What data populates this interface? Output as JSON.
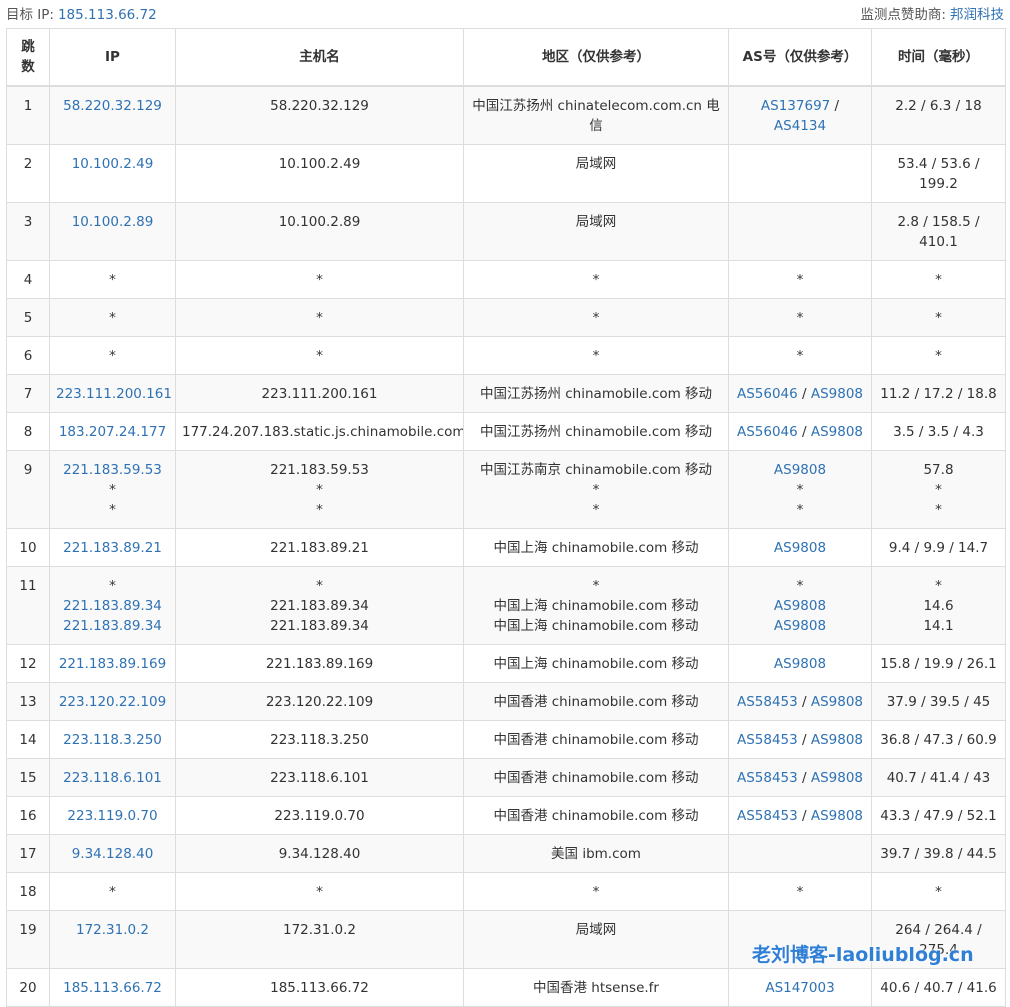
{
  "header": {
    "target_label": "目标 IP:",
    "target_ip": "185.113.66.72",
    "sponsor_label": "监测点赞助商:",
    "sponsor_name": "邦润科技"
  },
  "columns": [
    "跳数",
    "IP",
    "主机名",
    "地区（仅供参考）",
    "AS号（仅供参考）",
    "时间（毫秒）"
  ],
  "rows": [
    {
      "hop": "1",
      "ip": [
        "58.220.32.129"
      ],
      "host": [
        "58.220.32.129"
      ],
      "region": [
        "中国江苏扬州 chinatelecom.com.cn 电信"
      ],
      "as": [
        [
          "AS137697",
          "AS4134"
        ]
      ],
      "time": [
        "2.2 / 6.3 / 18"
      ]
    },
    {
      "hop": "2",
      "ip": [
        "10.100.2.49"
      ],
      "host": [
        "10.100.2.49"
      ],
      "region": [
        "局域网"
      ],
      "as": [
        []
      ],
      "time": [
        "53.4 / 53.6 / 199.2"
      ]
    },
    {
      "hop": "3",
      "ip": [
        "10.100.2.89"
      ],
      "host": [
        "10.100.2.89"
      ],
      "region": [
        "局域网"
      ],
      "as": [
        []
      ],
      "time": [
        "2.8 / 158.5 / 410.1"
      ]
    },
    {
      "hop": "4",
      "ip": [
        "*"
      ],
      "host": [
        "*"
      ],
      "region": [
        "*"
      ],
      "as": [
        [
          "*"
        ]
      ],
      "time": [
        "*"
      ]
    },
    {
      "hop": "5",
      "ip": [
        "*"
      ],
      "host": [
        "*"
      ],
      "region": [
        "*"
      ],
      "as": [
        [
          "*"
        ]
      ],
      "time": [
        "*"
      ]
    },
    {
      "hop": "6",
      "ip": [
        "*"
      ],
      "host": [
        "*"
      ],
      "region": [
        "*"
      ],
      "as": [
        [
          "*"
        ]
      ],
      "time": [
        "*"
      ]
    },
    {
      "hop": "7",
      "ip": [
        "223.111.200.161"
      ],
      "host": [
        "223.111.200.161"
      ],
      "region": [
        "中国江苏扬州 chinamobile.com 移动"
      ],
      "as": [
        [
          "AS56046",
          "AS9808"
        ]
      ],
      "time": [
        "11.2 / 17.2 / 18.8"
      ]
    },
    {
      "hop": "8",
      "ip": [
        "183.207.24.177"
      ],
      "host": [
        "177.24.207.183.static.js.chinamobile.com"
      ],
      "region": [
        "中国江苏扬州 chinamobile.com 移动"
      ],
      "as": [
        [
          "AS56046",
          "AS9808"
        ]
      ],
      "time": [
        "3.5 / 3.5 / 4.3"
      ]
    },
    {
      "hop": "9",
      "ip": [
        "221.183.59.53",
        "*",
        "*"
      ],
      "host": [
        "221.183.59.53",
        "*",
        "*"
      ],
      "region": [
        "中国江苏南京 chinamobile.com 移动",
        "*",
        "*"
      ],
      "as": [
        [
          "AS9808"
        ],
        [
          "*"
        ],
        [
          "*"
        ]
      ],
      "time": [
        "57.8",
        "*",
        "*"
      ]
    },
    {
      "hop": "10",
      "ip": [
        "221.183.89.21"
      ],
      "host": [
        "221.183.89.21"
      ],
      "region": [
        "中国上海 chinamobile.com 移动"
      ],
      "as": [
        [
          "AS9808"
        ]
      ],
      "time": [
        "9.4 / 9.9 / 14.7"
      ]
    },
    {
      "hop": "11",
      "ip": [
        "*",
        "221.183.89.34",
        "221.183.89.34"
      ],
      "host": [
        "*",
        "221.183.89.34",
        "221.183.89.34"
      ],
      "region": [
        "*",
        "中国上海 chinamobile.com 移动",
        "中国上海 chinamobile.com 移动"
      ],
      "as": [
        [
          "*"
        ],
        [
          "AS9808"
        ],
        [
          "AS9808"
        ]
      ],
      "time": [
        "*",
        "14.6",
        "14.1"
      ]
    },
    {
      "hop": "12",
      "ip": [
        "221.183.89.169"
      ],
      "host": [
        "221.183.89.169"
      ],
      "region": [
        "中国上海 chinamobile.com 移动"
      ],
      "as": [
        [
          "AS9808"
        ]
      ],
      "time": [
        "15.8 / 19.9 / 26.1"
      ]
    },
    {
      "hop": "13",
      "ip": [
        "223.120.22.109"
      ],
      "host": [
        "223.120.22.109"
      ],
      "region": [
        "中国香港 chinamobile.com 移动"
      ],
      "as": [
        [
          "AS58453",
          "AS9808"
        ]
      ],
      "time": [
        "37.9 / 39.5 / 45"
      ]
    },
    {
      "hop": "14",
      "ip": [
        "223.118.3.250"
      ],
      "host": [
        "223.118.3.250"
      ],
      "region": [
        "中国香港 chinamobile.com 移动"
      ],
      "as": [
        [
          "AS58453",
          "AS9808"
        ]
      ],
      "time": [
        "36.8 / 47.3 / 60.9"
      ]
    },
    {
      "hop": "15",
      "ip": [
        "223.118.6.101"
      ],
      "host": [
        "223.118.6.101"
      ],
      "region": [
        "中国香港 chinamobile.com 移动"
      ],
      "as": [
        [
          "AS58453",
          "AS9808"
        ]
      ],
      "time": [
        "40.7 / 41.4 / 43"
      ]
    },
    {
      "hop": "16",
      "ip": [
        "223.119.0.70"
      ],
      "host": [
        "223.119.0.70"
      ],
      "region": [
        "中国香港 chinamobile.com 移动"
      ],
      "as": [
        [
          "AS58453",
          "AS9808"
        ]
      ],
      "time": [
        "43.3 / 47.9 / 52.1"
      ]
    },
    {
      "hop": "17",
      "ip": [
        "9.34.128.40"
      ],
      "host": [
        "9.34.128.40"
      ],
      "region": [
        "美国 ibm.com"
      ],
      "as": [
        []
      ],
      "time": [
        "39.7 / 39.8 / 44.5"
      ]
    },
    {
      "hop": "18",
      "ip": [
        "*"
      ],
      "host": [
        "*"
      ],
      "region": [
        "*"
      ],
      "as": [
        [
          "*"
        ]
      ],
      "time": [
        "*"
      ]
    },
    {
      "hop": "19",
      "ip": [
        "172.31.0.2"
      ],
      "host": [
        "172.31.0.2"
      ],
      "region": [
        "局域网"
      ],
      "as": [
        []
      ],
      "time": [
        "264 / 264.4 / 275.4"
      ]
    },
    {
      "hop": "20",
      "ip": [
        "185.113.66.72"
      ],
      "host": [
        "185.113.66.72"
      ],
      "region": [
        "中国香港 htsense.fr"
      ],
      "as": [
        [
          "AS147003"
        ]
      ],
      "time": [
        "40.6 / 40.7 / 41.6"
      ]
    }
  ],
  "watermark": "老刘博客-laoliublog.cn",
  "colors": {
    "link": "#2f72b4",
    "border": "#dddddd",
    "stripe": "#f9f9f9",
    "watermark": "#2f7fd6"
  }
}
